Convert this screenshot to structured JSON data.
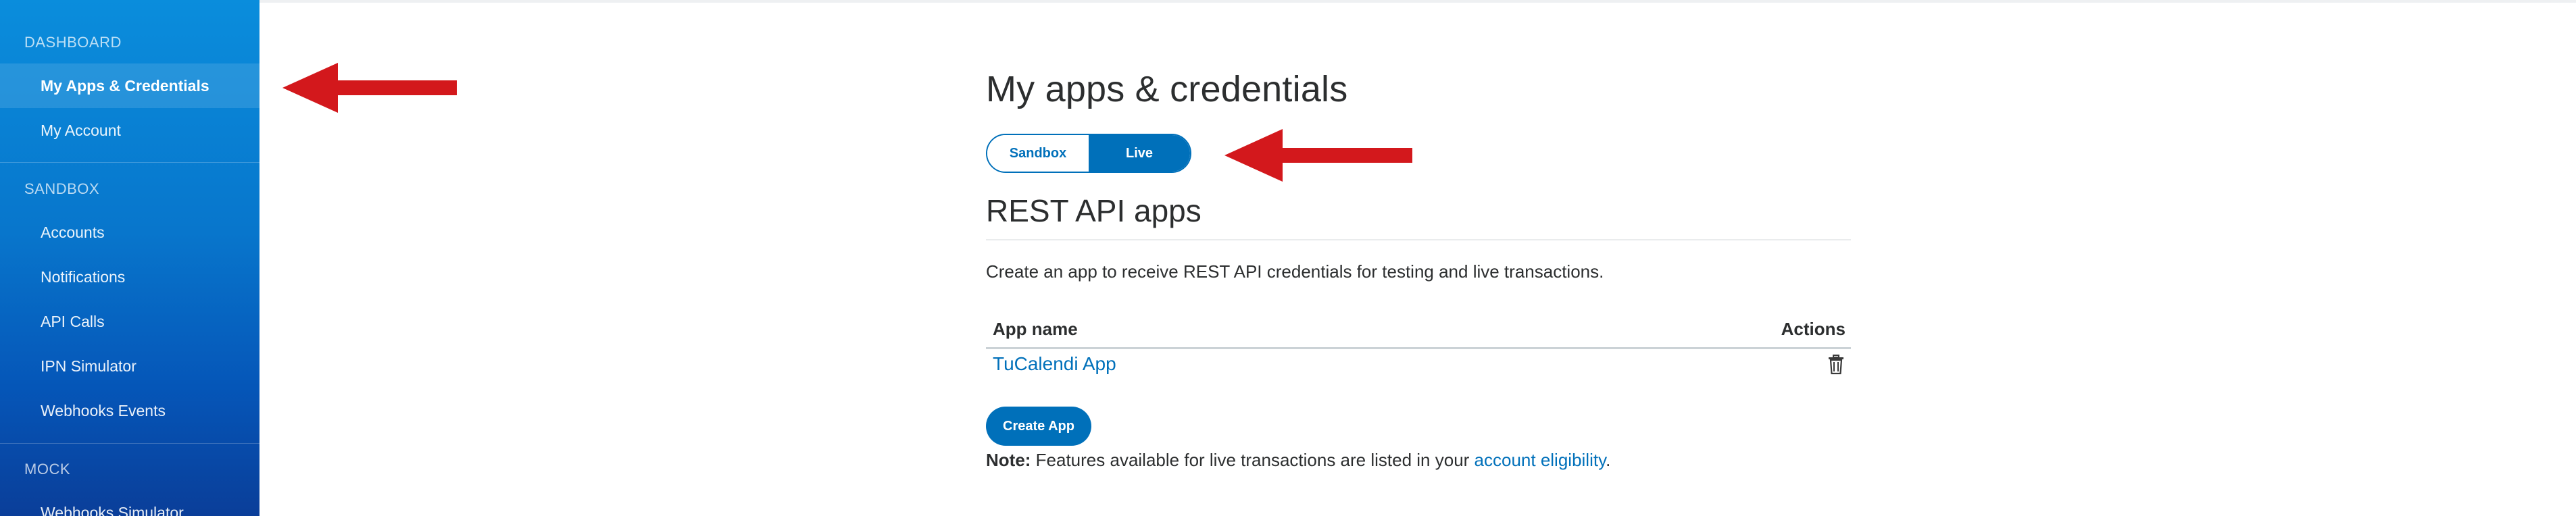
{
  "sidebar": {
    "sections": [
      {
        "title": "DASHBOARD",
        "items": [
          "My Apps & Credentials",
          "My Account"
        ]
      },
      {
        "title": "SANDBOX",
        "items": [
          "Accounts",
          "Notifications",
          "API Calls",
          "IPN Simulator",
          "Webhooks Events"
        ]
      },
      {
        "title": "MOCK",
        "items": [
          "Webhooks Simulator"
        ]
      }
    ],
    "active_item": "My Apps & Credentials"
  },
  "main": {
    "title": "My apps & credentials",
    "toggle": {
      "sandbox": "Sandbox",
      "live": "Live",
      "selected": "Live"
    },
    "section_title": "REST API apps",
    "description": "Create an app to receive REST API credentials for testing and live transactions.",
    "table": {
      "columns": [
        "App name",
        "Actions"
      ],
      "rows": [
        {
          "app_name": "TuCalendi App",
          "action_icon": "trash-icon"
        }
      ]
    },
    "create_button": "Create App",
    "note": {
      "label": "Note:",
      "text": " Features available for live transactions are listed in your ",
      "link": "account eligibility",
      "end": "."
    }
  },
  "colors": {
    "accent": "#0070ba",
    "sidebar_top": "#0a8ddc",
    "sidebar_bottom": "#0a3e99",
    "arrow": "#d3181c"
  },
  "annotations": {
    "arrows": 2
  }
}
